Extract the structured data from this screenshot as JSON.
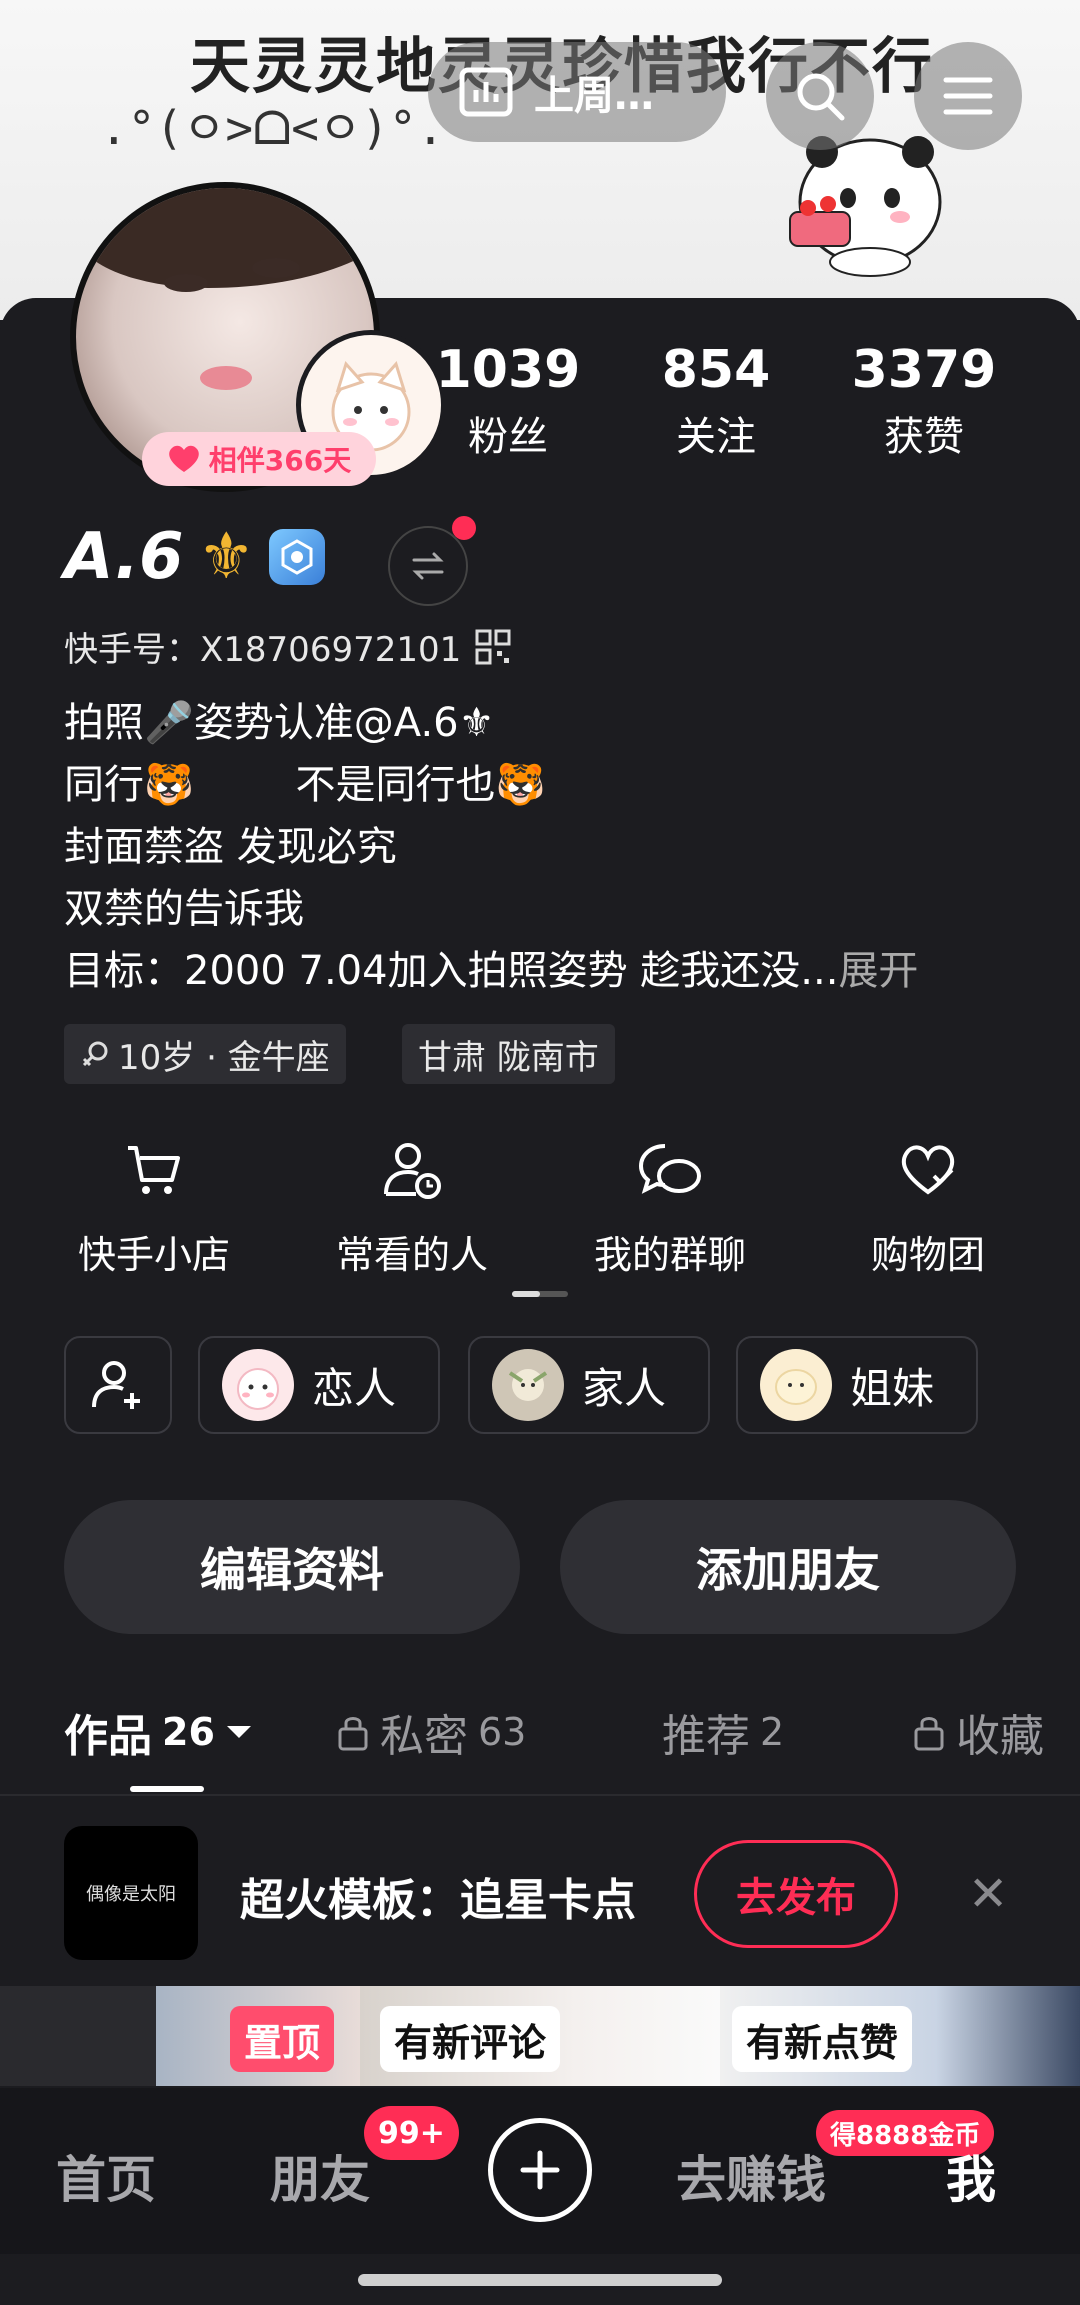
{
  "banner": {
    "headline": "天灵灵地灵灵珍惜我行不行",
    "emoticon": ".°(ㅇ>ᗝ<ㅇ)°.",
    "history_label": "上周…",
    "icons": [
      "chart-icon",
      "search-icon",
      "menu-icon"
    ]
  },
  "profile": {
    "companion_label": "相伴366天",
    "name": "A.6",
    "name_emoji": "⚜",
    "kuaishou_id_label": "快手号：X18706972101",
    "bio_lines": [
      "拍照🎤姿势认准@A.6⚜",
      "同行🐯        不是同行也🐯",
      "封面禁盗 发现必究",
      "双禁的告诉我",
      "目标：2000 7.04加入拍照姿势 趁我还没..."
    ],
    "bio_expand": "展开",
    "tags": [
      "10岁 · 金牛座",
      "甘肃 陇南市"
    ]
  },
  "stats": [
    {
      "value": "1039",
      "label": "粉丝"
    },
    {
      "value": "854",
      "label": "关注"
    },
    {
      "value": "3379",
      "label": "获赞"
    }
  ],
  "services": [
    {
      "label": "快手小店",
      "icon": "cart-icon"
    },
    {
      "label": "常看的人",
      "icon": "user-clock-icon"
    },
    {
      "label": "我的群聊",
      "icon": "chat-icon"
    },
    {
      "label": "购物团",
      "icon": "heart-icon"
    }
  ],
  "relations": [
    "恋人",
    "家人",
    "姐妹"
  ],
  "actions": {
    "edit": "编辑资料",
    "add_friend": "添加朋友"
  },
  "tabs": [
    {
      "label": "作品",
      "count": "26",
      "active": true,
      "locked": false
    },
    {
      "label": "私密",
      "count": "63",
      "active": false,
      "locked": true
    },
    {
      "label": "推荐",
      "count": "2",
      "active": false,
      "locked": false
    },
    {
      "label": "收藏",
      "count": "",
      "active": false,
      "locked": true
    }
  ],
  "promo": {
    "thumb_text": "偶像是太阳",
    "text": "超火模板：追星卡点",
    "button": "去发布"
  },
  "thumbs": {
    "pinned": "置顶",
    "new_comment": "有新评论",
    "new_like": "有新点赞"
  },
  "nav": {
    "home": "首页",
    "friends": "朋友",
    "friends_badge": "99+",
    "earn": "去赚钱",
    "earn_badge": "得8888金币",
    "me": "我"
  },
  "colors": {
    "accent": "#ff2d55",
    "background": "#1c1c20",
    "gold": "#f2b632"
  }
}
